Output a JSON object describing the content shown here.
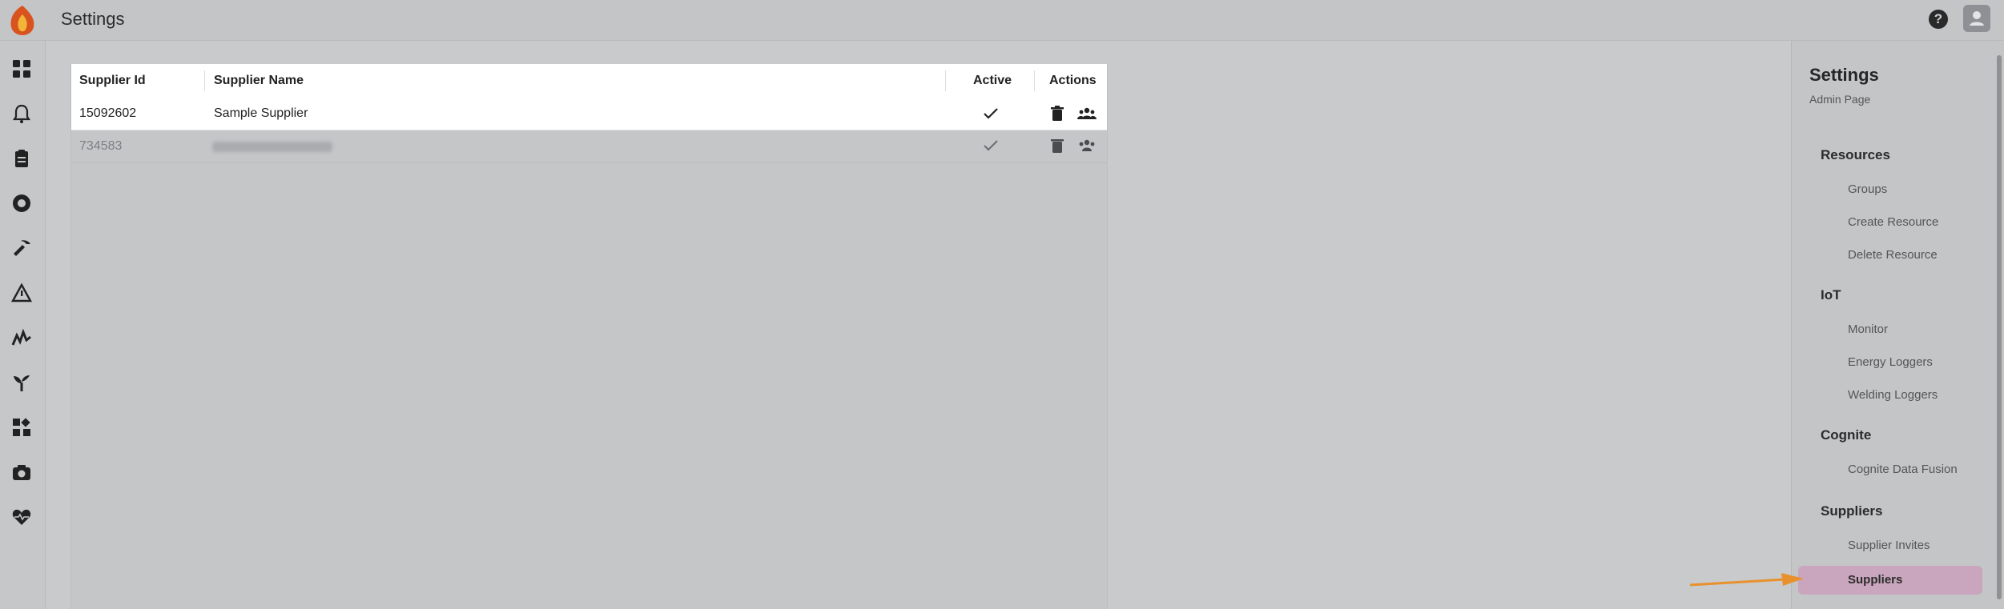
{
  "header": {
    "title": "Settings"
  },
  "rail": {
    "icons": [
      "dashboard-icon",
      "bell-icon",
      "clipboard-icon",
      "chart-circle-icon",
      "tool-icon",
      "warning-icon",
      "analytics-icon",
      "plant-icon",
      "widgets-icon",
      "camera-icon",
      "heart-monitor-icon"
    ]
  },
  "table": {
    "columns": [
      "Supplier Id",
      "Supplier Name",
      "Active",
      "Actions"
    ],
    "rows": [
      {
        "id": "15092602",
        "name": "Sample Supplier",
        "active": true
      },
      {
        "id": "734583",
        "name": "",
        "active": true
      }
    ]
  },
  "panel": {
    "title": "Settings",
    "subtitle": "Admin Page",
    "sections": [
      {
        "heading": "Resources",
        "items": [
          "Groups",
          "Create Resource",
          "Delete Resource"
        ]
      },
      {
        "heading": "IoT",
        "items": [
          "Monitor",
          "Energy Loggers",
          "Welding Loggers"
        ]
      },
      {
        "heading": "Cognite",
        "items": [
          "Cognite Data Fusion"
        ]
      },
      {
        "heading": "Suppliers",
        "items": [
          "Supplier Invites",
          "Suppliers"
        ]
      }
    ],
    "active_item": "Suppliers"
  },
  "colors": {
    "accent": "#c9a6bd",
    "arrow": "#e8912c",
    "logo": "#d9531e"
  }
}
